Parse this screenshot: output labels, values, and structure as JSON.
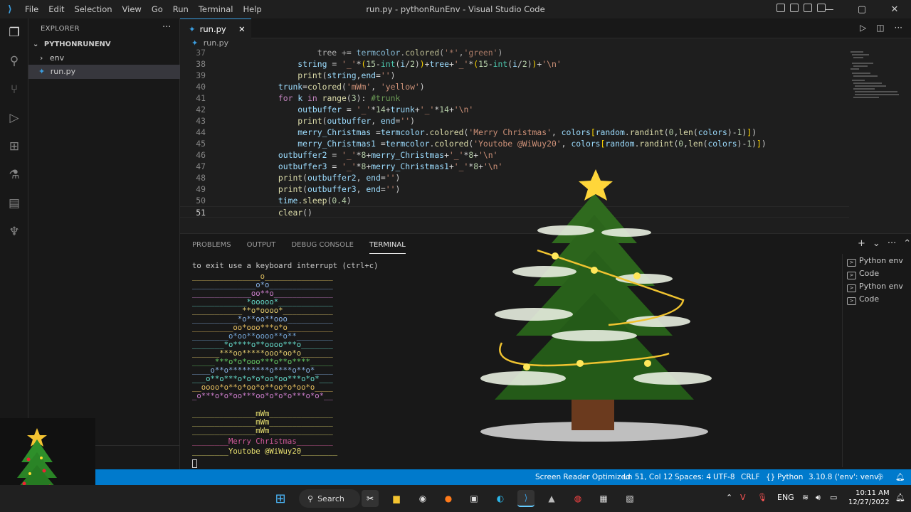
{
  "titlebar": {
    "menu": [
      "File",
      "Edit",
      "Selection",
      "View",
      "Go",
      "Run",
      "Terminal",
      "Help"
    ],
    "title": "run.py - pythonRunEnv - Visual Studio Code"
  },
  "sidebar": {
    "header": "EXPLORER",
    "folder": "PYTHONRUNENV",
    "items": [
      "env",
      "run.py"
    ]
  },
  "editor": {
    "tab": "run.py",
    "breadcrumb": "run.py"
  },
  "code": [
    {
      "n": "37",
      "t": "                tree += termcolor.colored('*','green')"
    },
    {
      "n": "38",
      "t": "string"
    },
    {
      "n": "39",
      "t": ""
    },
    {
      "n": "40",
      "t": ""
    },
    {
      "n": "41",
      "t": ""
    },
    {
      "n": "42",
      "t": ""
    },
    {
      "n": "43",
      "t": ""
    },
    {
      "n": "44",
      "t": ""
    },
    {
      "n": "45",
      "t": ""
    },
    {
      "n": "46",
      "t": ""
    },
    {
      "n": "47",
      "t": ""
    },
    {
      "n": "48",
      "t": ""
    },
    {
      "n": "49",
      "t": ""
    },
    {
      "n": "50",
      "t": ""
    },
    {
      "n": "51",
      "t": ""
    }
  ],
  "panel": {
    "tabs": [
      "PROBLEMS",
      "OUTPUT",
      "DEBUG CONSOLE",
      "TERMINAL"
    ],
    "terminals": [
      "Python env",
      "Code",
      "Python env",
      "Code"
    ]
  },
  "terminal": {
    "exit_msg": "to exit use a keyboard interrupt (ctrl+c)",
    "lines": [
      "_______________o_______________",
      "______________o*o______________",
      "_____________oo**o_____________",
      "____________*ooooo*____________",
      "___________**o*oooo*___________",
      "__________*o**oo**ooo__________",
      "_________oo*ooo***o*o__________",
      "________o*oo**oooo**o**________",
      "_______*o****o**oooo***o_______",
      "______***oo*****ooo*oo*o_______",
      "_____***o*o*ooo***o**o****_____",
      "____o**o*********o****o**o*____",
      "___o**o***o*o*o*oo*oo***o*o*___",
      "__oooo*o**o*oo*o**oo*o*oo*o____",
      "_o***o*o*oo***oo*o*o*o***o*o*__",
      "______________mWm______________",
      "______________mWm______________",
      "______________mWm______________"
    ],
    "merry": "________Merry Christmas________",
    "youtube": "________Youtobe @WiWuy20________"
  },
  "status": {
    "reader": "Screen Reader Optimized",
    "pos": "Ln 51, Col 12",
    "spaces": "Spaces: 4",
    "enc": "UTF-8",
    "eol": "CRLF",
    "lang": "Python",
    "interp": "3.10.8 ('env': venv)"
  },
  "taskbar": {
    "search": "Search",
    "lang": "ENG",
    "time": "10:11 AM",
    "date": "12/27/2022"
  }
}
